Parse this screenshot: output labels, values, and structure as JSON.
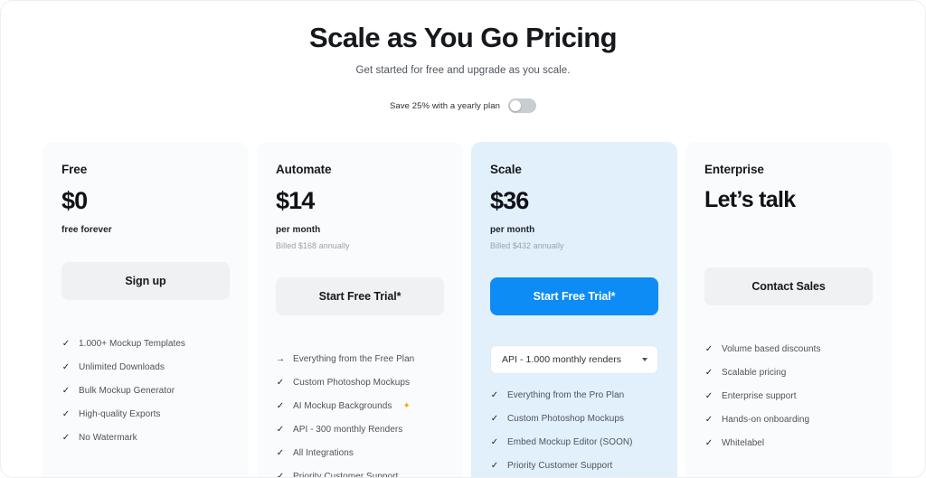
{
  "hero": {
    "title": "Scale as You Go Pricing",
    "subtitle": "Get started for free and upgrade as you scale.",
    "billing_label": "Save 25% with a yearly plan",
    "toggle_state": "off"
  },
  "colors": {
    "accent": "#0c8cf4",
    "highlight_card_bg": "#e2f0fb",
    "card_bg": "#fafbfc",
    "grey_button": "#f0f1f3",
    "sparkle": "#f5a623"
  },
  "plans": [
    {
      "name": "Free",
      "price": "$0",
      "period": "free forever",
      "billed": "",
      "cta": "Sign up",
      "cta_style": "grey",
      "highlight": false,
      "select": null,
      "features": [
        {
          "icon": "check",
          "text": "1.000+ Mockup Templates"
        },
        {
          "icon": "check",
          "text": "Unlimited Downloads"
        },
        {
          "icon": "check",
          "text": "Bulk Mockup Generator"
        },
        {
          "icon": "check",
          "text": "High-quality Exports"
        },
        {
          "icon": "check",
          "text": "No Watermark"
        }
      ]
    },
    {
      "name": "Automate",
      "price": "$14",
      "period": "per month",
      "billed": "Billed $168 annually",
      "cta": "Start Free Trial*",
      "cta_style": "grey",
      "highlight": false,
      "select": null,
      "features": [
        {
          "icon": "arrow",
          "text": "Everything from the Free Plan"
        },
        {
          "icon": "check",
          "text": "Custom Photoshop Mockups"
        },
        {
          "icon": "check",
          "text": "AI Mockup Backgrounds",
          "sparkle": "✦"
        },
        {
          "icon": "check",
          "text": "API - 300 monthly Renders"
        },
        {
          "icon": "check",
          "text": "All Integrations"
        },
        {
          "icon": "check",
          "text": "Priority Customer Support"
        }
      ]
    },
    {
      "name": "Scale",
      "price": "$36",
      "period": "per month",
      "billed": "Billed $432 annually",
      "cta": "Start Free Trial*",
      "cta_style": "blue",
      "highlight": true,
      "select": {
        "value": "API - 1.000 monthly renders"
      },
      "features": [
        {
          "icon": "check",
          "text": "Everything from the Pro Plan"
        },
        {
          "icon": "check",
          "text": "Custom Photoshop Mockups"
        },
        {
          "icon": "check",
          "text": "Embed Mockup Editor (SOON)"
        },
        {
          "icon": "check",
          "text": "Priority Customer Support"
        }
      ]
    },
    {
      "name": "Enterprise",
      "price": "Let’s talk",
      "period": "",
      "billed": "",
      "cta": "Contact Sales",
      "cta_style": "grey",
      "highlight": false,
      "select": null,
      "features": [
        {
          "icon": "check",
          "text": "Volume based discounts"
        },
        {
          "icon": "check",
          "text": "Scalable pricing"
        },
        {
          "icon": "check",
          "text": "Enterprise support"
        },
        {
          "icon": "check",
          "text": "Hands-on onboarding"
        },
        {
          "icon": "check",
          "text": "Whitelabel"
        }
      ]
    }
  ],
  "icons": {
    "check": "✓",
    "arrow": "→"
  }
}
